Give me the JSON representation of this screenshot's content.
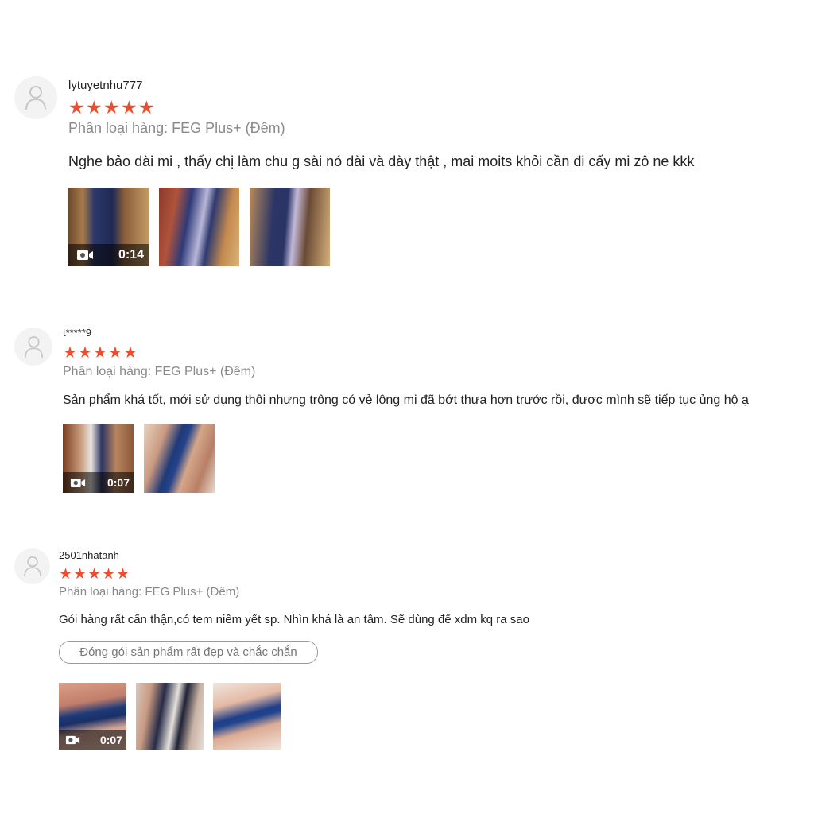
{
  "reviews": [
    {
      "username": "lytuyetnhu777",
      "rating": 5,
      "variant": "Phân loại hàng: FEG Plus+ (Đêm)",
      "comment": "Nghe bảo dài mi , thấy chị làm chu g sài nó dài và dày thật , mai moits khỏi cần đi cấy mi zô ne kkk",
      "media": [
        {
          "type": "video",
          "duration": "0:14"
        },
        {
          "type": "image"
        },
        {
          "type": "image"
        }
      ]
    },
    {
      "username": "t*****9",
      "rating": 5,
      "variant": "Phân loại hàng: FEG Plus+ (Đêm)",
      "comment": "Sản phẩm khá tốt, mới sử dụng thôi nhưng trông có vẻ lông mi đã bớt thưa hơn trước rồi, được mình sẽ tiếp tục ủng hộ ạ",
      "media": [
        {
          "type": "video",
          "duration": "0:07"
        },
        {
          "type": "image"
        }
      ]
    },
    {
      "username": "2501nhatanh",
      "rating": 5,
      "variant": "Phân loại hàng: FEG Plus+ (Đêm)",
      "comment": "Gói hàng rất cẩn thận,có tem niêm yết sp. Nhìn khá là an tâm. Sẽ dùng để xdm kq ra sao",
      "tag": "Đóng gói sản phẩm rất đẹp và chắc chắn",
      "media": [
        {
          "type": "video",
          "duration": "0:07"
        },
        {
          "type": "image"
        },
        {
          "type": "image"
        }
      ]
    }
  ],
  "icons": {
    "avatar": "user-silhouette-icon",
    "star": "star-icon",
    "video": "video-camera-icon"
  },
  "colors": {
    "star": "#ee4d2d",
    "variant_text": "#8a8a8a",
    "avatar_bg": "#f3f3f3"
  }
}
